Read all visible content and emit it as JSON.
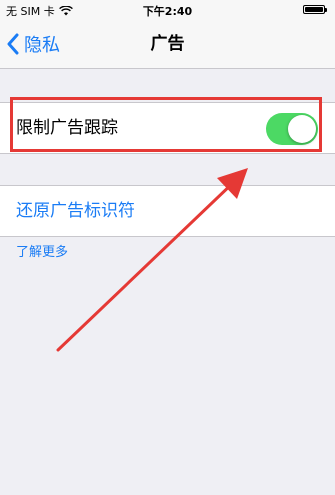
{
  "status_bar": {
    "carrier": "无 SIM 卡",
    "time": "下午2:40",
    "wifi_icon": "wifi-icon",
    "battery_icon": "battery-icon"
  },
  "nav": {
    "back_label": "隐私",
    "back_icon": "chevron-left-icon",
    "title": "广告"
  },
  "settings": {
    "limit_ad_tracking_label": "限制广告跟踪",
    "limit_ad_tracking_on": true,
    "reset_ad_identifier_label": "还原广告标识符",
    "learn_more_label": "了解更多"
  },
  "colors": {
    "accent": "#1a7cf5",
    "toggle_on": "#4cd964",
    "annotation_red": "#e53935",
    "background": "#efeff4"
  }
}
